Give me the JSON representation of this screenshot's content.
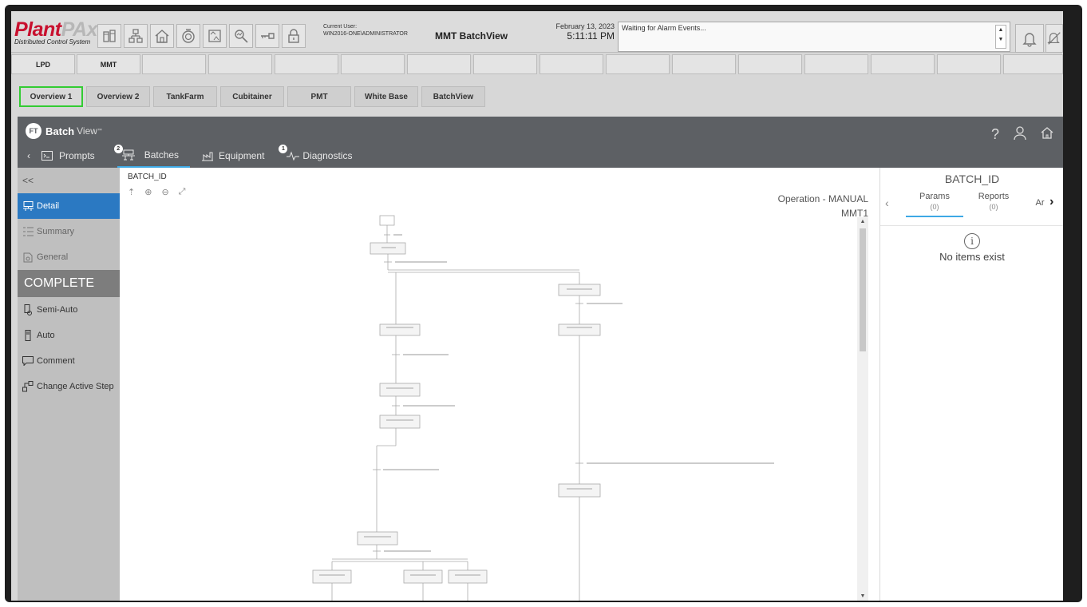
{
  "header": {
    "logo_main": "PlantPAx",
    "logo_sub": "Distributed Control System",
    "current_user_label": "Current User:",
    "current_user": "WIN2016-ONE\\ADMINISTRATOR",
    "app_name": "MMT BatchView",
    "date": "February 13, 2023",
    "time": "5:11:11 PM",
    "alarm_text": "Waiting for Alarm Events...",
    "icons": [
      "area-icon",
      "hierarchy-icon",
      "home-icon",
      "batch-icon",
      "trend-icon",
      "search-chart-icon",
      "key-icon",
      "lock-icon"
    ]
  },
  "row1_tabs": [
    "LPD",
    "MMT",
    "",
    "",
    "",
    "",
    "",
    "",
    "",
    "",
    "",
    "",
    "",
    "",
    "",
    "",
    ""
  ],
  "row2_tabs": [
    "Overview 1",
    "Overview 2",
    "TankFarm",
    "Cubitainer",
    "PMT",
    "White Base",
    "BatchView"
  ],
  "batchview": {
    "logo_batch": "Batch",
    "logo_view": "View",
    "logo_tm": "™",
    "logo_badge": "FT",
    "nav": {
      "prompts": "Prompts",
      "batches": "Batches",
      "batches_badge": "2",
      "equipment": "Equipment",
      "diagnostics": "Diagnostics",
      "diagnostics_badge": "1"
    },
    "side_collapse": "<<",
    "side_items": [
      "Detail",
      "Summary",
      "General"
    ],
    "status": "COMPLETE",
    "actions": [
      "Semi-Auto",
      "Auto",
      "Comment",
      "Change Active Step"
    ],
    "batch_id": "BATCH_ID",
    "operation_mode": "Operation - MANUAL",
    "unit": "MMT1",
    "right": {
      "title": "BATCH_ID",
      "tabs": [
        {
          "label": "Params",
          "count": "(0)"
        },
        {
          "label": "Reports",
          "count": "(0)"
        },
        {
          "label": "Ar",
          "count": ""
        }
      ],
      "empty": "No items exist"
    }
  },
  "colors": {
    "brand_red": "#c8102e",
    "selected_blue": "#2b79c2",
    "accent_blue": "#3ea9e5",
    "active_tab_green": "#33cc33",
    "bv_header": "#5d6064"
  }
}
